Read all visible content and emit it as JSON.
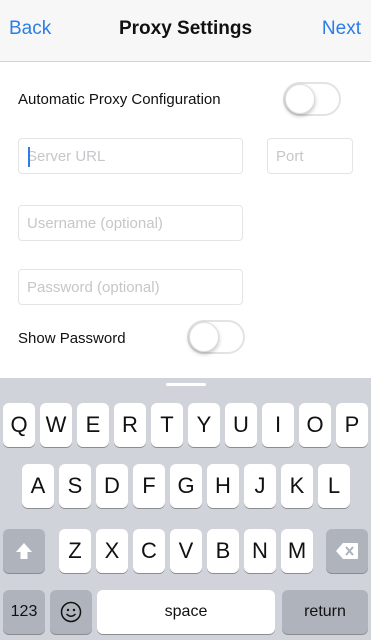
{
  "navbar": {
    "back_label": "Back",
    "title": "Proxy Settings",
    "next_label": "Next"
  },
  "form": {
    "auto_proxy_label": "Automatic Proxy Configuration",
    "auto_proxy_on": false,
    "server_url_placeholder": "Server URL",
    "port_placeholder": "Port",
    "username_placeholder": "Username (optional)",
    "password_placeholder": "Password (optional)",
    "show_password_label": "Show Password",
    "show_password_on": false
  },
  "keyboard": {
    "row1": [
      "Q",
      "W",
      "E",
      "R",
      "T",
      "Y",
      "U",
      "I",
      "O",
      "P"
    ],
    "row2": [
      "A",
      "S",
      "D",
      "F",
      "G",
      "H",
      "J",
      "K",
      "L"
    ],
    "row3": [
      "Z",
      "X",
      "C",
      "V",
      "B",
      "N",
      "M"
    ],
    "numbers_label": "123",
    "space_label": "space",
    "return_label": "return",
    "icons": {
      "shift": "shift-icon",
      "delete": "delete-icon",
      "emoji": "emoji-icon"
    }
  },
  "colors": {
    "accent": "#2a7ee8",
    "keyboard_bg": "#d0d3d9",
    "function_key": "#aeb3bc"
  }
}
